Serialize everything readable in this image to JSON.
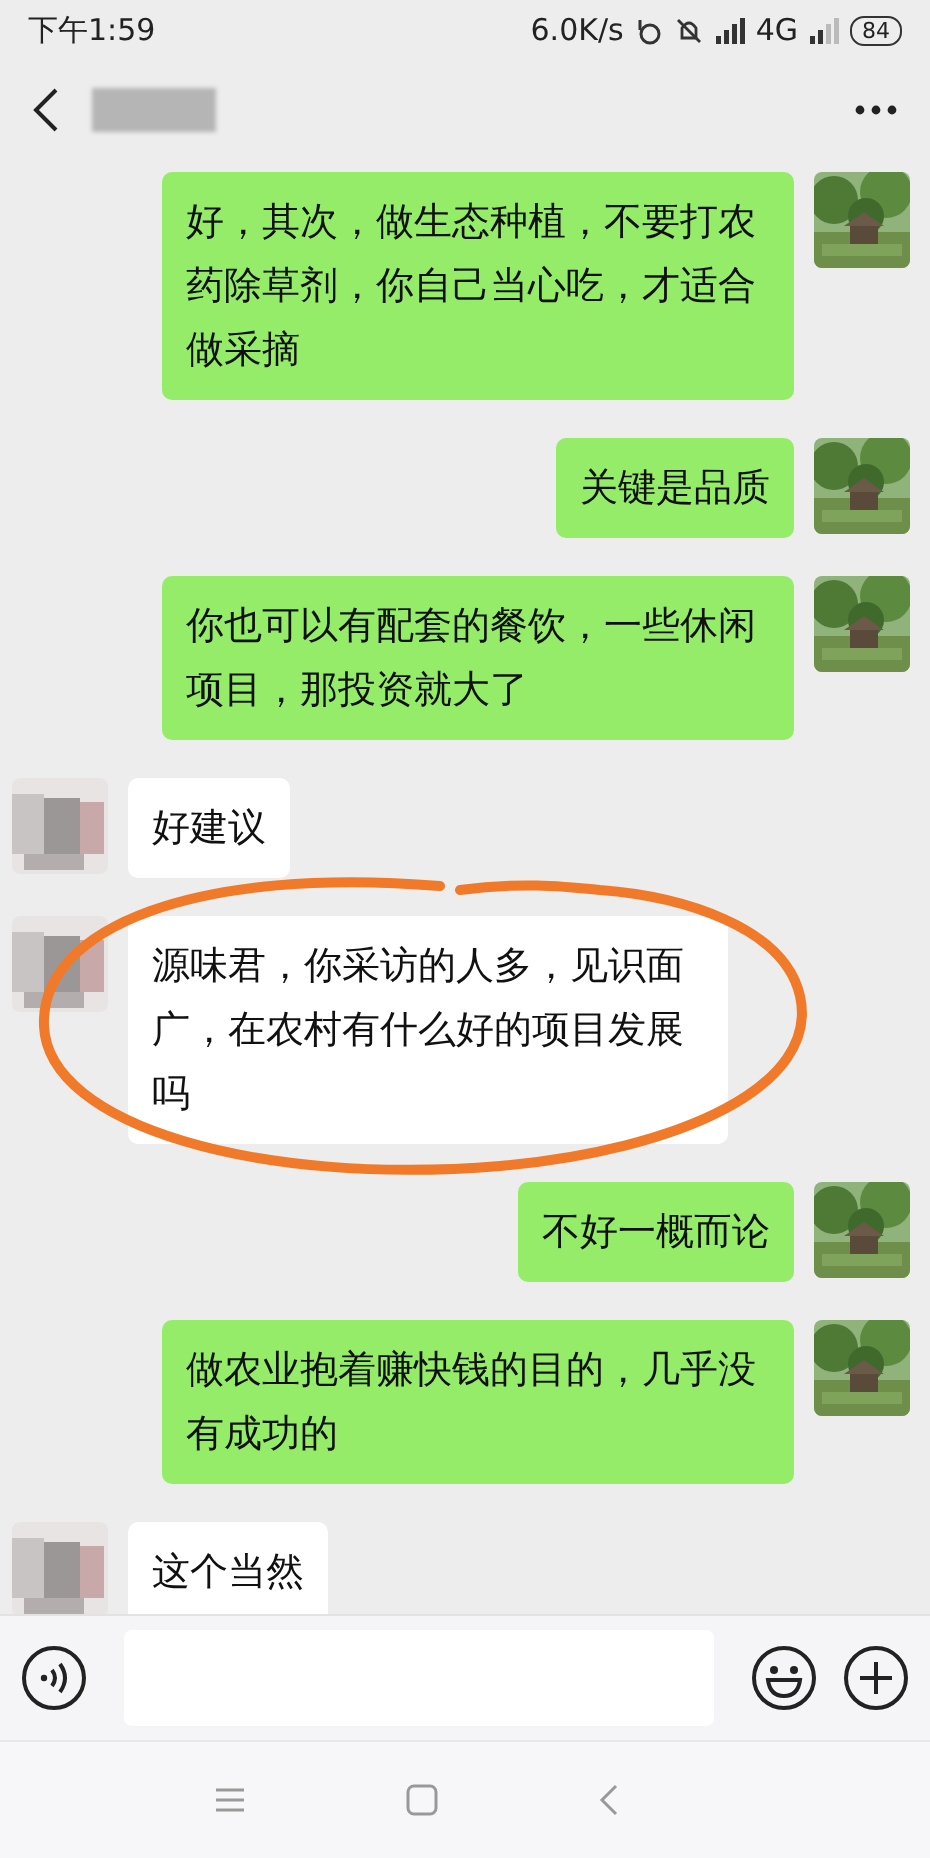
{
  "status_bar": {
    "time": "下午1:59",
    "network_speed": "6.0K/s",
    "network_type": "4G",
    "battery": "84"
  },
  "messages": [
    {
      "kind": "right",
      "text": "好，其次，做生态种植，不要打农药除草剂，你自己当心吃，才适合做采摘"
    },
    {
      "kind": "right",
      "text": "关键是品质"
    },
    {
      "kind": "right",
      "text": "你也可以有配套的餐饮，一些休闲项目，那投资就大了"
    },
    {
      "kind": "left",
      "text": "好建议"
    },
    {
      "kind": "left",
      "text": "源味君，你采访的人多，见识面广，在农村有什么好的项目发展吗",
      "highlighted": true
    },
    {
      "kind": "right",
      "text": "不好一概而论"
    },
    {
      "kind": "right",
      "text": "做农业抱着赚快钱的目的，几乎没有成功的"
    },
    {
      "kind": "left",
      "text": "这个当然"
    }
  ]
}
